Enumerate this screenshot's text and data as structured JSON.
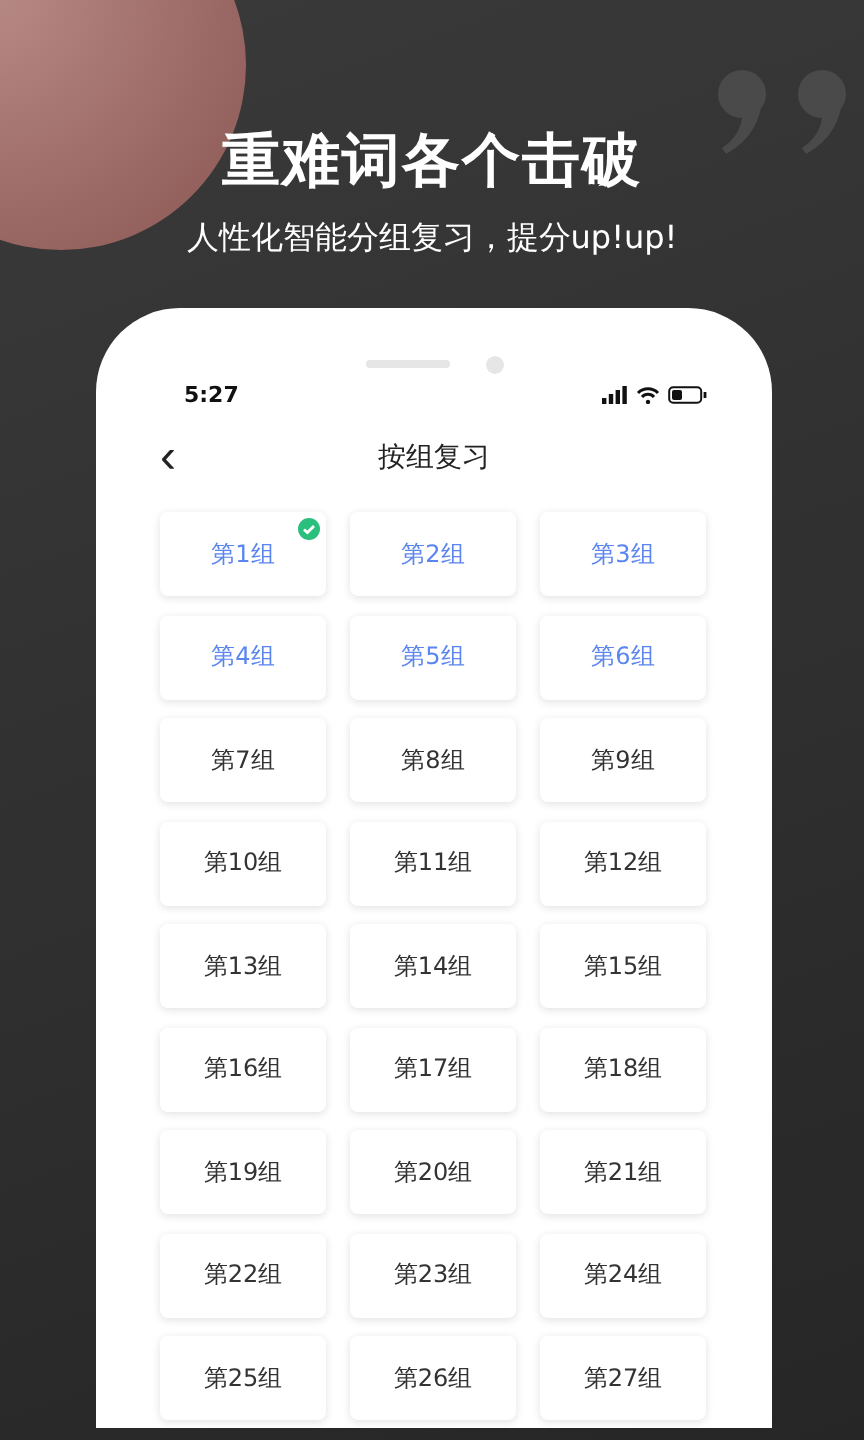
{
  "headline": "重难词各个击破",
  "subtitle": "人性化智能分组复习，提分up!up!",
  "status_bar": {
    "time": "5:27"
  },
  "nav": {
    "back": "‹",
    "title": "按组复习"
  },
  "groups": [
    {
      "label": "第1组",
      "selected": true,
      "checked": true
    },
    {
      "label": "第2组",
      "selected": true,
      "checked": false
    },
    {
      "label": "第3组",
      "selected": true,
      "checked": false
    },
    {
      "label": "第4组",
      "selected": true,
      "checked": false
    },
    {
      "label": "第5组",
      "selected": true,
      "checked": false
    },
    {
      "label": "第6组",
      "selected": true,
      "checked": false
    },
    {
      "label": "第7组",
      "selected": false,
      "checked": false
    },
    {
      "label": "第8组",
      "selected": false,
      "checked": false
    },
    {
      "label": "第9组",
      "selected": false,
      "checked": false
    },
    {
      "label": "第10组",
      "selected": false,
      "checked": false
    },
    {
      "label": "第11组",
      "selected": false,
      "checked": false
    },
    {
      "label": "第12组",
      "selected": false,
      "checked": false
    },
    {
      "label": "第13组",
      "selected": false,
      "checked": false
    },
    {
      "label": "第14组",
      "selected": false,
      "checked": false
    },
    {
      "label": "第15组",
      "selected": false,
      "checked": false
    },
    {
      "label": "第16组",
      "selected": false,
      "checked": false
    },
    {
      "label": "第17组",
      "selected": false,
      "checked": false
    },
    {
      "label": "第18组",
      "selected": false,
      "checked": false
    },
    {
      "label": "第19组",
      "selected": false,
      "checked": false
    },
    {
      "label": "第20组",
      "selected": false,
      "checked": false
    },
    {
      "label": "第21组",
      "selected": false,
      "checked": false
    },
    {
      "label": "第22组",
      "selected": false,
      "checked": false
    },
    {
      "label": "第23组",
      "selected": false,
      "checked": false
    },
    {
      "label": "第24组",
      "selected": false,
      "checked": false
    },
    {
      "label": "第25组",
      "selected": false,
      "checked": false
    },
    {
      "label": "第26组",
      "selected": false,
      "checked": false
    },
    {
      "label": "第27组",
      "selected": false,
      "checked": false
    }
  ]
}
